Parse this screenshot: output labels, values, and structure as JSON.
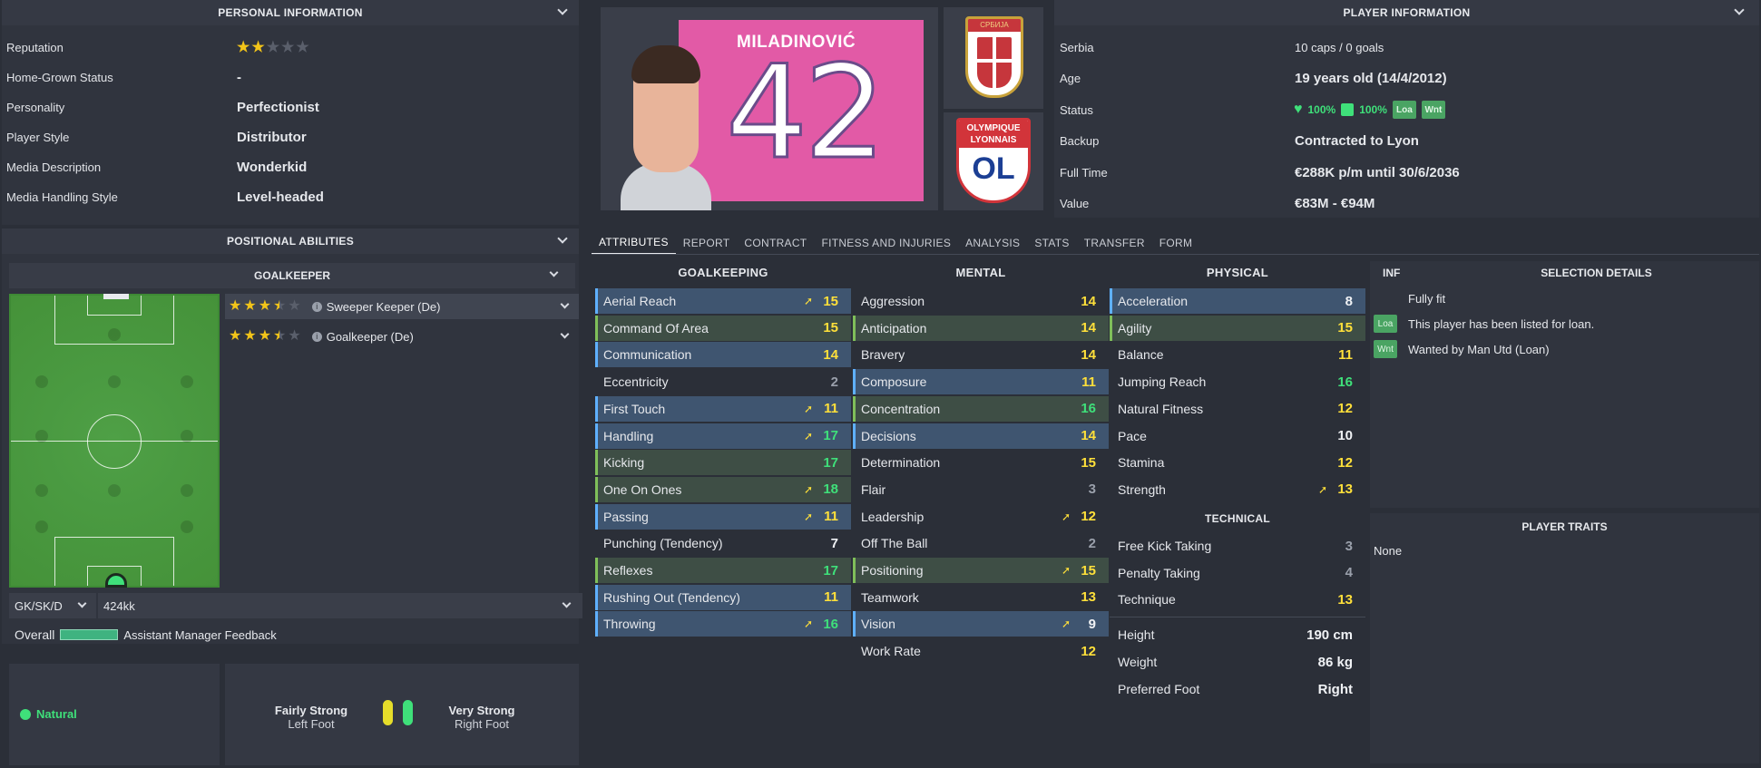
{
  "personal": {
    "title": "PERSONAL INFORMATION",
    "rows": [
      {
        "label": "Reputation",
        "value": ""
      },
      {
        "label": "Home-Grown Status",
        "value": "-"
      },
      {
        "label": "Personality",
        "value": "Perfectionist"
      },
      {
        "label": "Player Style",
        "value": "Distributor"
      },
      {
        "label": "Media Description",
        "value": "Wonderkid"
      },
      {
        "label": "Media Handling Style",
        "value": "Level-headed"
      }
    ],
    "reputation_stars": 2
  },
  "positional": {
    "title": "POSITIONAL ABILITIES",
    "group": "GOALKEEPER",
    "roles": [
      {
        "name": "Sweeper Keeper (De)",
        "stars": 3.5
      },
      {
        "name": "Goalkeeper (De)",
        "stars": 3.5
      }
    ],
    "position_select": "GK/SK/D",
    "tactic_select": "424kk",
    "overall_label": "Overall",
    "feedback_label": "Assistant Manager Feedback"
  },
  "foot": {
    "natural_label": "Natural",
    "left_strength": "Fairly Strong",
    "left_label": "Left Foot",
    "right_strength": "Very Strong",
    "right_label": "Right Foot"
  },
  "player_card": {
    "name": "MILADINOVIĆ",
    "number": "42",
    "country_badge_text": "СРБИЈА",
    "club_badge_text1": "OLYMPIQUE",
    "club_badge_text2": "LYONNAIS",
    "club_badge_letters": "OL"
  },
  "player_info": {
    "title": "PLAYER INFORMATION",
    "rows": [
      {
        "label": "Serbia",
        "value": "10 caps / 0 goals"
      },
      {
        "label": "Age",
        "value": "19 years old (14/4/2012)"
      },
      {
        "label": "Status",
        "value": ""
      },
      {
        "label": "Backup",
        "value": "Contracted to Lyon"
      },
      {
        "label": "Full Time",
        "value": "€288K p/m until 30/6/2036"
      },
      {
        "label": "Value",
        "value": "€83M - €94M"
      }
    ],
    "status_fitness": "100%",
    "status_sharpness": "100%",
    "status_badge1": "Loa",
    "status_badge2": "Wnt"
  },
  "tabs": [
    "ATTRIBUTES",
    "REPORT",
    "CONTRACT",
    "FITNESS AND INJURIES",
    "ANALYSIS",
    "STATS",
    "TRANSFER",
    "FORM"
  ],
  "attributes": {
    "goalkeeping_title": "GOALKEEPING",
    "mental_title": "MENTAL",
    "physical_title": "PHYSICAL",
    "technical_title": "TECHNICAL",
    "goalkeeping": [
      {
        "name": "Aerial Reach",
        "value": "15",
        "bg": "blue",
        "arrow": true,
        "color": "yellow"
      },
      {
        "name": "Command Of Area",
        "value": "15",
        "bg": "green",
        "arrow": false,
        "color": "yellow"
      },
      {
        "name": "Communication",
        "value": "14",
        "bg": "blue",
        "arrow": false,
        "color": "yellow"
      },
      {
        "name": "Eccentricity",
        "value": "2",
        "bg": "none",
        "arrow": false,
        "color": "grey"
      },
      {
        "name": "First Touch",
        "value": "11",
        "bg": "blue",
        "arrow": true,
        "color": "yellow"
      },
      {
        "name": "Handling",
        "value": "17",
        "bg": "blue",
        "arrow": true,
        "color": "green"
      },
      {
        "name": "Kicking",
        "value": "17",
        "bg": "green",
        "arrow": false,
        "color": "green"
      },
      {
        "name": "One On Ones",
        "value": "18",
        "bg": "green",
        "arrow": true,
        "color": "green"
      },
      {
        "name": "Passing",
        "value": "11",
        "bg": "blue",
        "arrow": true,
        "color": "yellow"
      },
      {
        "name": "Punching (Tendency)",
        "value": "7",
        "bg": "none",
        "arrow": false,
        "color": "white"
      },
      {
        "name": "Reflexes",
        "value": "17",
        "bg": "green",
        "arrow": false,
        "color": "green"
      },
      {
        "name": "Rushing Out (Tendency)",
        "value": "11",
        "bg": "blue",
        "arrow": false,
        "color": "yellow"
      },
      {
        "name": "Throwing",
        "value": "16",
        "bg": "blue",
        "arrow": true,
        "color": "green"
      }
    ],
    "mental": [
      {
        "name": "Aggression",
        "value": "14",
        "bg": "none",
        "arrow": false,
        "color": "yellow"
      },
      {
        "name": "Anticipation",
        "value": "14",
        "bg": "green",
        "arrow": false,
        "color": "yellow"
      },
      {
        "name": "Bravery",
        "value": "14",
        "bg": "none",
        "arrow": false,
        "color": "yellow"
      },
      {
        "name": "Composure",
        "value": "11",
        "bg": "blue",
        "arrow": false,
        "color": "yellow"
      },
      {
        "name": "Concentration",
        "value": "16",
        "bg": "green",
        "arrow": false,
        "color": "green"
      },
      {
        "name": "Decisions",
        "value": "14",
        "bg": "blue",
        "arrow": false,
        "color": "yellow"
      },
      {
        "name": "Determination",
        "value": "15",
        "bg": "none",
        "arrow": false,
        "color": "yellow"
      },
      {
        "name": "Flair",
        "value": "3",
        "bg": "none",
        "arrow": false,
        "color": "grey"
      },
      {
        "name": "Leadership",
        "value": "12",
        "bg": "none",
        "arrow": true,
        "color": "yellow"
      },
      {
        "name": "Off The Ball",
        "value": "2",
        "bg": "none",
        "arrow": false,
        "color": "grey"
      },
      {
        "name": "Positioning",
        "value": "15",
        "bg": "green",
        "arrow": true,
        "color": "yellow"
      },
      {
        "name": "Teamwork",
        "value": "13",
        "bg": "none",
        "arrow": false,
        "color": "yellow"
      },
      {
        "name": "Vision",
        "value": "9",
        "bg": "blue",
        "arrow": true,
        "color": "white"
      },
      {
        "name": "Work Rate",
        "value": "12",
        "bg": "none",
        "arrow": false,
        "color": "yellow"
      }
    ],
    "physical": [
      {
        "name": "Acceleration",
        "value": "8",
        "bg": "blue",
        "arrow": false,
        "color": "white"
      },
      {
        "name": "Agility",
        "value": "15",
        "bg": "green",
        "arrow": false,
        "color": "yellow"
      },
      {
        "name": "Balance",
        "value": "11",
        "bg": "none",
        "arrow": false,
        "color": "yellow"
      },
      {
        "name": "Jumping Reach",
        "value": "16",
        "bg": "none",
        "arrow": false,
        "color": "green"
      },
      {
        "name": "Natural Fitness",
        "value": "12",
        "bg": "none",
        "arrow": false,
        "color": "yellow"
      },
      {
        "name": "Pace",
        "value": "10",
        "bg": "none",
        "arrow": false,
        "color": "white"
      },
      {
        "name": "Stamina",
        "value": "12",
        "bg": "none",
        "arrow": false,
        "color": "yellow"
      },
      {
        "name": "Strength",
        "value": "13",
        "bg": "none",
        "arrow": true,
        "color": "yellow"
      }
    ],
    "technical": [
      {
        "name": "Free Kick Taking",
        "value": "3",
        "bg": "none",
        "arrow": false,
        "color": "grey"
      },
      {
        "name": "Penalty Taking",
        "value": "4",
        "bg": "none",
        "arrow": false,
        "color": "grey"
      },
      {
        "name": "Technique",
        "value": "13",
        "bg": "none",
        "arrow": false,
        "color": "yellow"
      }
    ],
    "body": [
      {
        "name": "Height",
        "value": "190 cm"
      },
      {
        "name": "Weight",
        "value": "86 kg"
      },
      {
        "name": "Preferred Foot",
        "value": "Right"
      }
    ]
  },
  "selection": {
    "inf_label": "INF",
    "title": "SELECTION DETAILS",
    "rows": [
      {
        "badge": "",
        "text": "Fully fit"
      },
      {
        "badge": "Loa",
        "text": "This player has been listed for loan."
      },
      {
        "badge": "Wnt",
        "text": "Wanted by Man Utd (Loan)"
      }
    ]
  },
  "traits": {
    "title": "PLAYER TRAITS",
    "value": "None"
  }
}
